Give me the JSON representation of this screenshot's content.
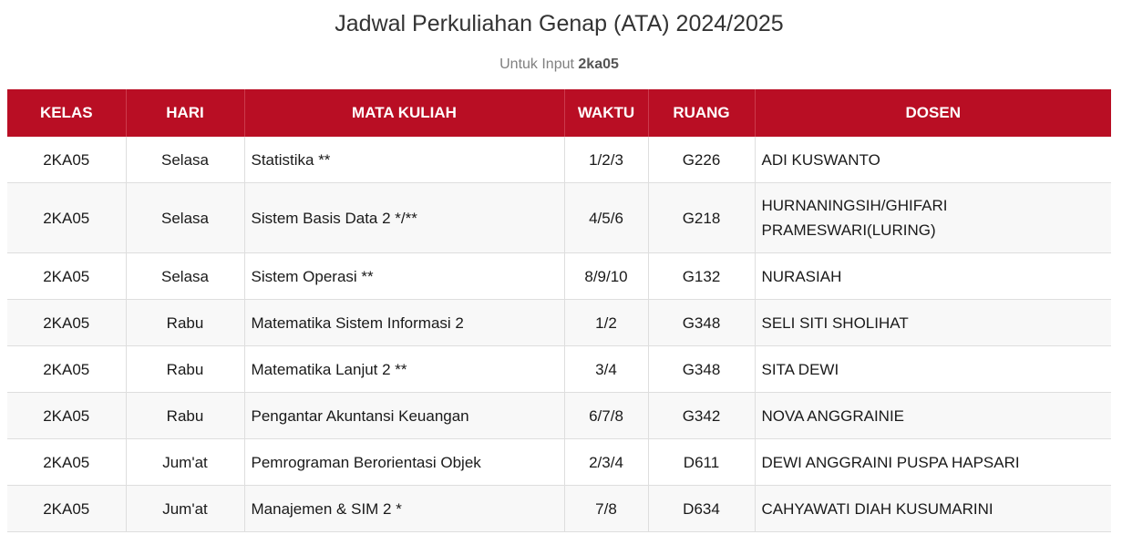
{
  "page": {
    "title": "Jadwal Perkuliahan Genap (ATA) 2024/2025",
    "subtitle_prefix": "Untuk Input",
    "subtitle_value": "2ka05"
  },
  "colors": {
    "header_background": "#b90e24",
    "header_text": "#ffffff",
    "row_alt_background": "#f8f8f8"
  },
  "table": {
    "headers": {
      "kelas": "KELAS",
      "hari": "HARI",
      "mata_kuliah": "MATA KULIAH",
      "waktu": "WAKTU",
      "ruang": "RUANG",
      "dosen": "DOSEN"
    },
    "rows": [
      {
        "kelas": "2KA05",
        "hari": "Selasa",
        "mata_kuliah": "Statistika **",
        "waktu": "1/2/3",
        "ruang": "G226",
        "dosen": "ADI KUSWANTO"
      },
      {
        "kelas": "2KA05",
        "hari": "Selasa",
        "mata_kuliah": "Sistem Basis Data 2 */**",
        "waktu": "4/5/6",
        "ruang": "G218",
        "dosen": "HURNANINGSIH/GHIFARI PRAMESWARI(LURING)"
      },
      {
        "kelas": "2KA05",
        "hari": "Selasa",
        "mata_kuliah": "Sistem Operasi **",
        "waktu": "8/9/10",
        "ruang": "G132",
        "dosen": "NURASIAH"
      },
      {
        "kelas": "2KA05",
        "hari": "Rabu",
        "mata_kuliah": "Matematika Sistem Informasi 2",
        "waktu": "1/2",
        "ruang": "G348",
        "dosen": "SELI SITI SHOLIHAT"
      },
      {
        "kelas": "2KA05",
        "hari": "Rabu",
        "mata_kuliah": "Matematika Lanjut 2 **",
        "waktu": "3/4",
        "ruang": "G348",
        "dosen": "SITA DEWI"
      },
      {
        "kelas": "2KA05",
        "hari": "Rabu",
        "mata_kuliah": "Pengantar Akuntansi Keuangan",
        "waktu": "6/7/8",
        "ruang": "G342",
        "dosen": "NOVA ANGGRAINIE"
      },
      {
        "kelas": "2KA05",
        "hari": "Jum'at",
        "mata_kuliah": "Pemrograman Berorientasi Objek",
        "waktu": "2/3/4",
        "ruang": "D611",
        "dosen": "DEWI ANGGRAINI PUSPA HAPSARI"
      },
      {
        "kelas": "2KA05",
        "hari": "Jum'at",
        "mata_kuliah": "Manajemen & SIM 2 *",
        "waktu": "7/8",
        "ruang": "D634",
        "dosen": "CAHYAWATI DIAH KUSUMARINI"
      }
    ]
  }
}
